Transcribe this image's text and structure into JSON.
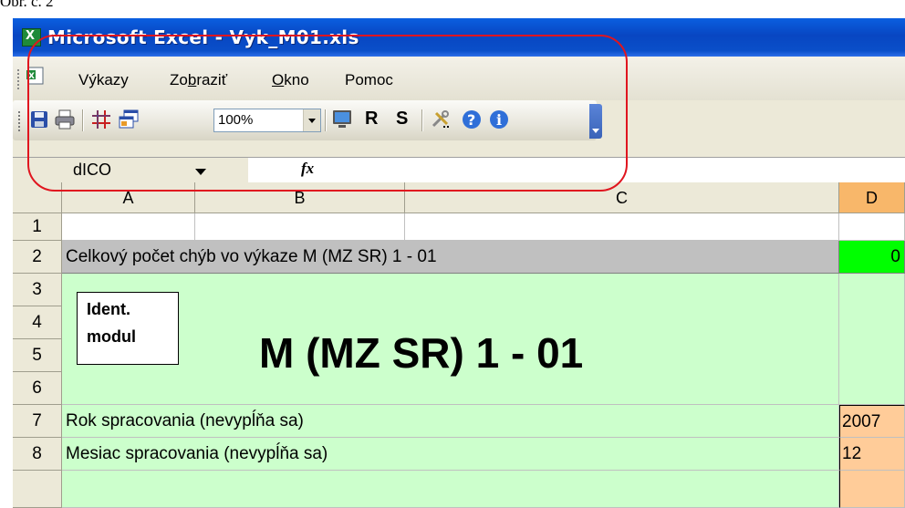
{
  "caption": "Obr. č. 2",
  "window": {
    "title": "Microsoft Excel - Vyk_M01.xls",
    "icon": "excel-icon"
  },
  "menu": [
    {
      "label": "Výkazy"
    },
    {
      "label": "Zobraziť"
    },
    {
      "label": "Okno"
    },
    {
      "label": "Pomoc"
    }
  ],
  "toolbar": {
    "zoom": "100%",
    "letter_r": "R",
    "letter_s": "S",
    "icons": [
      "save-icon",
      "print-icon",
      "gridlines-icon",
      "window-icon",
      "monitor-icon",
      "tools-icon",
      "help-icon",
      "info-icon"
    ]
  },
  "formula_bar": {
    "name_box": "dICO",
    "fx": "fx",
    "formula": ""
  },
  "columns": [
    "A",
    "B",
    "C",
    "D"
  ],
  "rows": [
    "1",
    "2",
    "3",
    "4",
    "5",
    "6",
    "7",
    "8"
  ],
  "cells": {
    "r2_text": "Celkový počet chýb vo výkaze M (MZ SR) 1 - 01",
    "r2_d": "0",
    "ident_line1": "Ident.",
    "ident_line2": "modul",
    "big_title": "M (MZ SR) 1 - 01",
    "r7_text": "Rok spracovania (nevypĺňa sa)",
    "r7_d": "2007",
    "r8_text": "Mesiac spracovania (nevypĺňa sa)",
    "r8_d": "12"
  },
  "colors": {
    "header_fill": "#c0c0c0",
    "green_fill": "#ccffcc",
    "bright_green": "#00ff00",
    "orange_fill": "#ffcc99",
    "active_col": "#f8b76a",
    "annotation": "#e0151f"
  }
}
